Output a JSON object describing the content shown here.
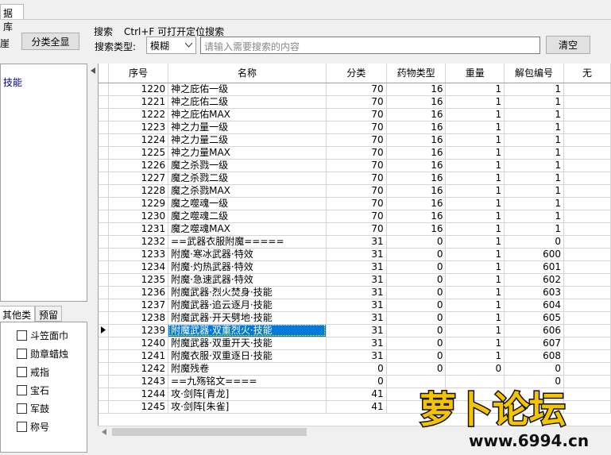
{
  "tab": {
    "label": "据库"
  },
  "left_edge": {
    "label": "崖"
  },
  "category_all_button": "分类全显",
  "search": {
    "title": "搜索",
    "hint": "Ctrl+F 可打开定位搜索",
    "type_label": "搜索类型:",
    "type_value": "模糊",
    "placeholder": "请输入需要搜索的内容",
    "clear_button": "清空"
  },
  "tree": {
    "item": "技能"
  },
  "left_tabs": [
    "其他类",
    "预留"
  ],
  "checkboxes": [
    "斗笠面巾",
    "勋章蜡烛",
    "戒指",
    "宝石",
    "军鼓",
    "称号"
  ],
  "columns": [
    "序号",
    "名称",
    "分类",
    "药物类型",
    "重量",
    "解包编号",
    "无"
  ],
  "rows": [
    {
      "id": "1220",
      "name": "神之庇佑一级",
      "cat": "70",
      "drug": "16",
      "weight": "1",
      "pack": "1"
    },
    {
      "id": "1221",
      "name": "神之庇佑二级",
      "cat": "70",
      "drug": "16",
      "weight": "1",
      "pack": "1"
    },
    {
      "id": "1222",
      "name": "神之庇佑MAX",
      "cat": "70",
      "drug": "16",
      "weight": "1",
      "pack": "1"
    },
    {
      "id": "1223",
      "name": "神之力量一级",
      "cat": "70",
      "drug": "16",
      "weight": "1",
      "pack": "1"
    },
    {
      "id": "1224",
      "name": "神之力量二级",
      "cat": "70",
      "drug": "16",
      "weight": "1",
      "pack": "1"
    },
    {
      "id": "1225",
      "name": "神之力量MAX",
      "cat": "70",
      "drug": "16",
      "weight": "1",
      "pack": "1"
    },
    {
      "id": "1226",
      "name": "魔之杀戮一级",
      "cat": "70",
      "drug": "16",
      "weight": "1",
      "pack": "1"
    },
    {
      "id": "1227",
      "name": "魔之杀戮二级",
      "cat": "70",
      "drug": "16",
      "weight": "1",
      "pack": "1"
    },
    {
      "id": "1228",
      "name": "魔之杀戮MAX",
      "cat": "70",
      "drug": "16",
      "weight": "1",
      "pack": "1"
    },
    {
      "id": "1229",
      "name": "魔之噬魂一级",
      "cat": "70",
      "drug": "16",
      "weight": "1",
      "pack": "1"
    },
    {
      "id": "1230",
      "name": "魔之噬魂二级",
      "cat": "70",
      "drug": "16",
      "weight": "1",
      "pack": "1"
    },
    {
      "id": "1231",
      "name": "魔之噬魂MAX",
      "cat": "70",
      "drug": "16",
      "weight": "1",
      "pack": "1"
    },
    {
      "id": "1232",
      "name": "==武器衣服附魔=====",
      "cat": "31",
      "drug": "0",
      "weight": "1",
      "pack": "0"
    },
    {
      "id": "1233",
      "name": "附魔·寒冰武器·特效",
      "cat": "31",
      "drug": "0",
      "weight": "1",
      "pack": "600"
    },
    {
      "id": "1234",
      "name": "附魔·灼热武器·特效",
      "cat": "31",
      "drug": "0",
      "weight": "1",
      "pack": "601"
    },
    {
      "id": "1235",
      "name": "附魔·急速武器·特效",
      "cat": "31",
      "drug": "0",
      "weight": "1",
      "pack": "602"
    },
    {
      "id": "1236",
      "name": "附魔武器·烈火焚身·技能",
      "cat": "31",
      "drug": "0",
      "weight": "1",
      "pack": "603"
    },
    {
      "id": "1237",
      "name": "附魔武器·追云逐月·技能",
      "cat": "31",
      "drug": "0",
      "weight": "1",
      "pack": "604"
    },
    {
      "id": "1238",
      "name": "附魔武器·开天劈地·技能",
      "cat": "31",
      "drug": "0",
      "weight": "1",
      "pack": "605"
    },
    {
      "id": "1239",
      "name": "附魔武器·双重烈火·技能",
      "cat": "31",
      "drug": "0",
      "weight": "1",
      "pack": "606"
    },
    {
      "id": "1240",
      "name": "附魔武器·双重开天·技能",
      "cat": "31",
      "drug": "0",
      "weight": "1",
      "pack": "607"
    },
    {
      "id": "1241",
      "name": "附魔衣服·双重逐日·技能",
      "cat": "31",
      "drug": "0",
      "weight": "1",
      "pack": "608"
    },
    {
      "id": "1242",
      "name": "附魔残卷",
      "cat": "0",
      "drug": "0",
      "weight": "0",
      "pack": "0"
    },
    {
      "id": "1243",
      "name": "==九殇铭文====",
      "cat": "0",
      "drug": "",
      "weight": "",
      "pack": "0"
    },
    {
      "id": "1244",
      "name": "攻·剑阵[青龙]",
      "cat": "41",
      "drug": "",
      "weight": "",
      "pack": ""
    },
    {
      "id": "1245",
      "name": "攻·剑阵[朱雀]",
      "cat": "41",
      "drug": "",
      "weight": "",
      "pack": ""
    }
  ],
  "selected_index": 19,
  "watermark": {
    "brand": "萝卜论坛",
    "url": "www.6994.cn"
  },
  "colors": {
    "selection": "#0078d7",
    "tree_text": "#00008b"
  }
}
